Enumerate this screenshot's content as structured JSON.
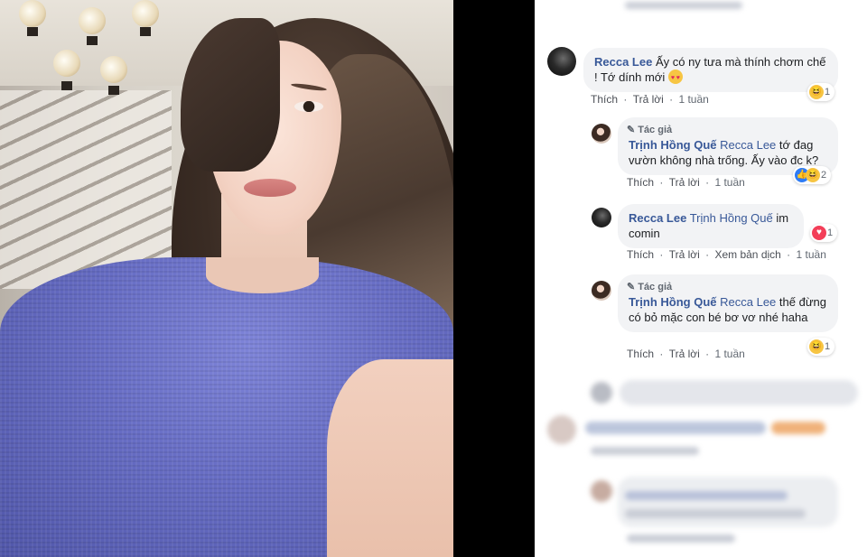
{
  "comments": [
    {
      "author": "Recca Lee",
      "text_before_emoji": "Ấy có ny tưa mà thính chơm chế ! Tớ dính mới",
      "emoji": "heart-eyes-emoji",
      "actions": {
        "like": "Thích",
        "reply": "Trả lời",
        "time": "1 tuần"
      },
      "reaction": {
        "icons": [
          "haha"
        ],
        "count": "1"
      }
    },
    {
      "badge": "Tác giả",
      "author": "Trịnh Hồng Quế",
      "mention": "Recca Lee",
      "text": "tớ đag vườn không nhà trống. Ấy vào đc k?",
      "actions": {
        "like": "Thích",
        "reply": "Trả lời",
        "time": "1 tuần"
      },
      "reaction": {
        "icons": [
          "like",
          "haha"
        ],
        "count": "2"
      }
    },
    {
      "author": "Recca Lee",
      "mention": "Trịnh Hồng Quế",
      "text": "im comin",
      "actions": {
        "like": "Thích",
        "reply": "Trả lời",
        "translate": "Xem bản dịch",
        "time": "1 tuần"
      },
      "reaction": {
        "icons": [
          "love"
        ],
        "count": "1"
      }
    },
    {
      "badge": "Tác giả",
      "author": "Trịnh Hồng Quế",
      "mention": "Recca Lee",
      "text": "thế đừng có bỏ mặc con bé bơ vơ nhé haha",
      "actions": {
        "like": "Thích",
        "reply": "Trả lời",
        "time": "1 tuần"
      },
      "reaction": {
        "icons": [
          "haha"
        ],
        "count": "1"
      }
    }
  ],
  "colors": {
    "link": "#385898",
    "bubble": "#f2f3f5",
    "meta": "#606770",
    "shirt": "#676dc4"
  }
}
